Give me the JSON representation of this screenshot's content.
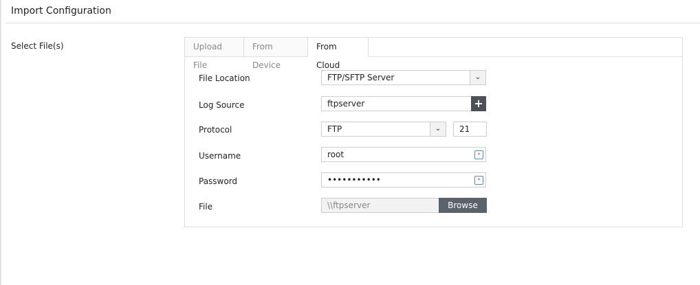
{
  "title": "Import Configuration",
  "select_label": "Select File(s)",
  "tabs": [
    "Upload File",
    "From Device",
    "From Cloud"
  ],
  "form": {
    "file_location_label": "File Location",
    "file_location": "FTP/SFTP Server",
    "log_source_label": "Log Source",
    "log_source": "ftpserver",
    "protocol_label": "Protocol",
    "protocol": "FTP",
    "port": "21",
    "username_label": "Username",
    "username": "root",
    "password_label": "Password",
    "password": "•••••••••••",
    "file_label": "File",
    "file_path": "\\\\ftpserver",
    "browse": "Browse"
  }
}
